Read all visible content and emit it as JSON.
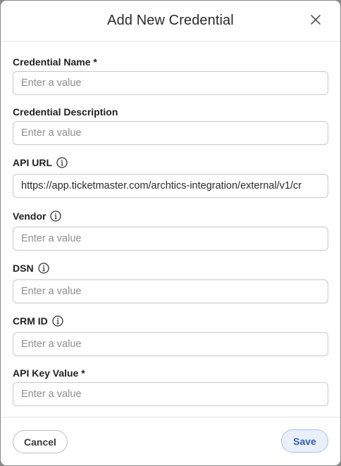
{
  "dialog": {
    "title": "Add New Credential",
    "close_icon": "close-icon"
  },
  "fields": {
    "credential_name": {
      "label": "Credential Name *",
      "placeholder": "Enter a value",
      "value": ""
    },
    "credential_description": {
      "label": "Credential Description",
      "placeholder": "Enter a value",
      "value": ""
    },
    "api_url": {
      "label": "API URL",
      "info_icon": "info-icon",
      "placeholder": "Enter a value",
      "value": "https://app.ticketmaster.com/archtics-integration/external/v1/cr"
    },
    "vendor": {
      "label": "Vendor",
      "info_icon": "info-icon",
      "placeholder": "Enter a value",
      "value": ""
    },
    "dsn": {
      "label": "DSN",
      "info_icon": "info-icon",
      "placeholder": "Enter a value",
      "value": ""
    },
    "crm_id": {
      "label": "CRM ID",
      "info_icon": "info-icon",
      "placeholder": "Enter a value",
      "value": ""
    },
    "api_key_value": {
      "label": "API Key Value *",
      "placeholder": "Enter a value",
      "value": ""
    }
  },
  "footer": {
    "cancel_label": "Cancel",
    "save_label": "Save"
  },
  "colors": {
    "save_bg": "#e9f0fa",
    "save_border": "#a9c1e4",
    "save_text": "#2f5fa8",
    "input_border": "#c9c9c9"
  }
}
